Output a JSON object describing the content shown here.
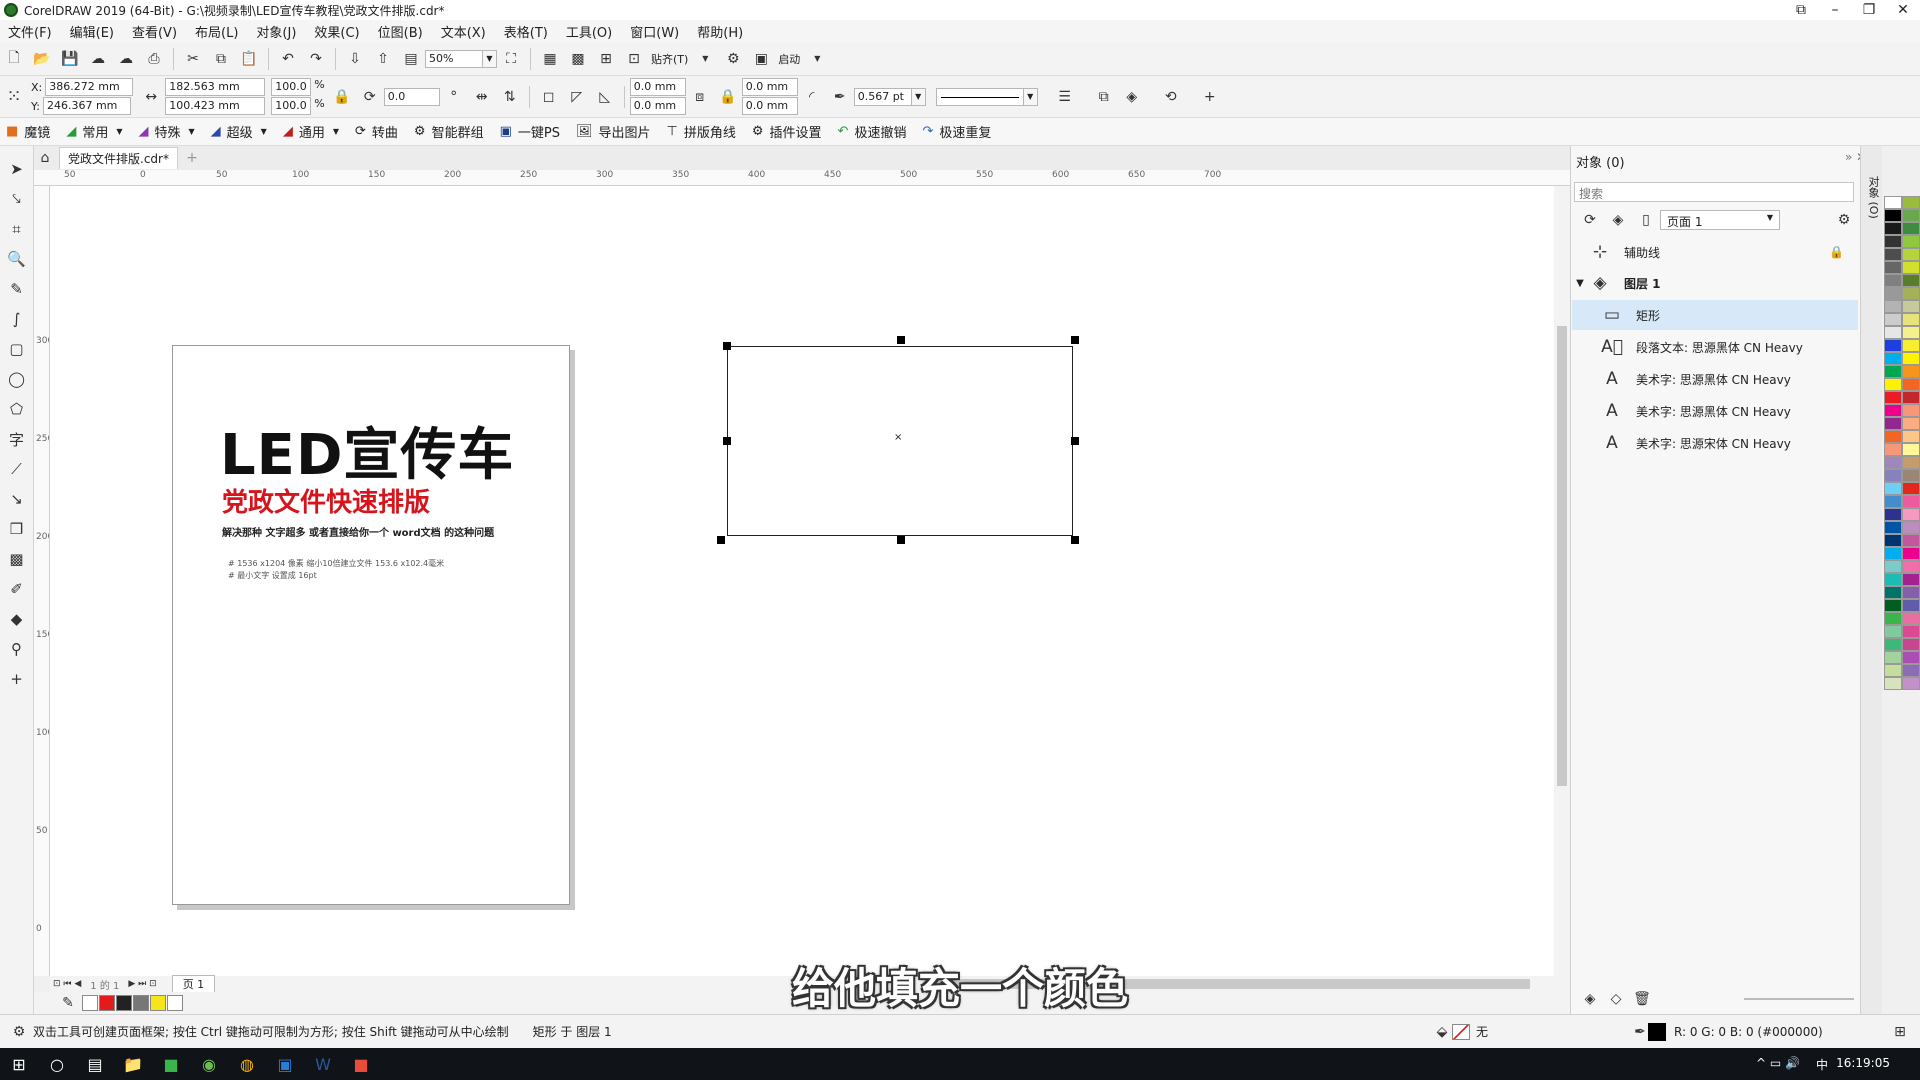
{
  "window": {
    "title": "CorelDRAW 2019 (64-Bit) - G:\\视频录制\\LED宣传车教程\\党政文件排版.cdr*"
  },
  "menu": [
    "文件(F)",
    "编辑(E)",
    "查看(V)",
    "布局(L)",
    "对象(J)",
    "效果(C)",
    "位图(B)",
    "文本(X)",
    "表格(T)",
    "工具(O)",
    "窗口(W)",
    "帮助(H)"
  ],
  "toolbar": {
    "zoom": "50%",
    "snap_label": "贴齐(T)",
    "launch_label": "启动"
  },
  "props": {
    "x": "386.272 mm",
    "y": "246.367 mm",
    "w": "182.563 mm",
    "h": "100.423 mm",
    "scale_w": "100.0",
    "scale_h": "100.0",
    "pct": "%",
    "rotation": "0.0",
    "corner_tl": "0.0 mm",
    "corner_bl": "0.0 mm",
    "corner_tr": "0.0 mm",
    "corner_br": "0.0 mm",
    "outline_width": "0.567 pt",
    "x_label": "X:",
    "y_label": "Y:"
  },
  "plugins": [
    "魔镜",
    "常用",
    "特殊",
    "超级",
    "通用",
    "转曲",
    "智能群组",
    "一键PS",
    "导出图片",
    "拼版角线",
    "插件设置",
    "极速撤销",
    "极速重复"
  ],
  "doc": {
    "tab": "党政文件排版.cdr*"
  },
  "ruler_h": [
    "50",
    "0",
    "50",
    "100",
    "150",
    "200",
    "250",
    "300",
    "350",
    "400",
    "450",
    "500",
    "550",
    "600",
    "650",
    "700"
  ],
  "ruler_v": [
    "300",
    "250",
    "200",
    "150",
    "100",
    "50",
    "0"
  ],
  "page": {
    "title": "LED宣传车",
    "subtitle": "党政文件快速排版",
    "desc": "解决那种 文字超多 或者直接给你一个 word文档 的这种问题",
    "note1": "#   1536 x1204 像素      缩小10倍建立文件 153.6 x102.4毫米",
    "note2": "#   最小文字 设置成 16pt"
  },
  "pagebar": {
    "nav": "1  的  1",
    "page_tab": "页 1"
  },
  "caption": "给他填充一个颜色",
  "objects_panel": {
    "title": "对象 (0)",
    "search_placeholder": "搜索",
    "page_select": "页面 1",
    "rows": [
      "辅助线",
      "图层 1",
      "矩形",
      "段落文本: 思源黑体 CN Heavy",
      "美术字: 思源黑体 CN Heavy",
      "美术字: 思源黑体 CN Heavy",
      "美术字: 思源宋体 CN Heavy"
    ]
  },
  "side_tab": "对象 (O)",
  "status": {
    "hint": "双击工具可创建页面框架; 按住 Ctrl 键拖动可限制为方形; 按住 Shift 键拖动可从中心绘制",
    "selection": "矩形 于 图层 1",
    "fill": "无",
    "color": "R: 0 G: 0 B: 0 (#000000)"
  },
  "taskbar": {
    "clock": "16:19:05",
    "ime": "中"
  },
  "colors": {
    "accent": "#d6141c",
    "selection_row": "#d7e8f8"
  }
}
